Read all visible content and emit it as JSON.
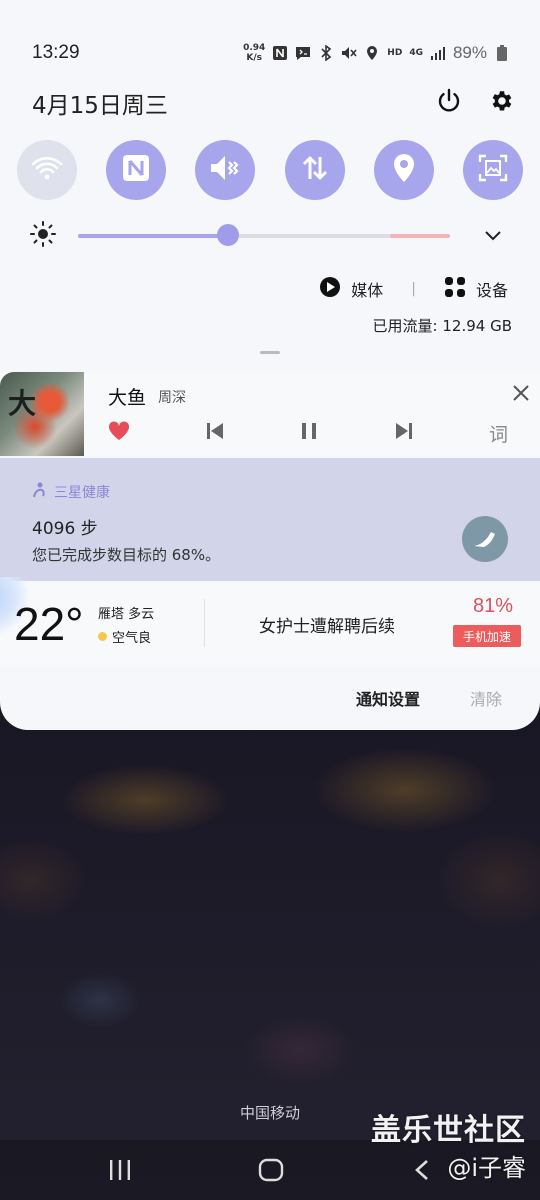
{
  "status_bar": {
    "time": "13:29",
    "net_speed_value": "0.94",
    "net_speed_unit": "K/s",
    "network_hd": "HD",
    "network_gen": "4G",
    "battery": "89%",
    "icons": [
      "nfc-icon",
      "message-icon",
      "bluetooth-icon",
      "mute-icon",
      "location-icon",
      "signal-icon",
      "battery-icon"
    ]
  },
  "header": {
    "date": "4月15日周三"
  },
  "quick_tiles": [
    {
      "name": "wifi",
      "icon": "wifi-icon",
      "state": "off"
    },
    {
      "name": "nfc",
      "icon": "nfc-icon",
      "state": "on"
    },
    {
      "name": "sound",
      "icon": "mute-icon",
      "state": "on"
    },
    {
      "name": "mobile-data",
      "icon": "data-arrows-icon",
      "state": "on"
    },
    {
      "name": "location",
      "icon": "location-icon",
      "state": "on"
    },
    {
      "name": "screenshot",
      "icon": "screen-capture-icon",
      "state": "on"
    }
  ],
  "brightness": {
    "level": 0.4
  },
  "media_row": {
    "media_label": "媒体",
    "separator": "|",
    "devices_label": "设备"
  },
  "data_usage": "已用流量: 12.94 GB",
  "music": {
    "album_glyph": "大",
    "title": "大鱼",
    "artist": "周深",
    "lyrics_label": "词"
  },
  "health": {
    "app_name": "三星健康",
    "steps": "4096 步",
    "progress_text": "您已完成步数目标的 68%。",
    "progress_fraction": 0.68
  },
  "weather": {
    "temperature": "22°",
    "city_condition": "雁塔 多云",
    "air_quality": "空气良"
  },
  "news": {
    "headline": "女护士遭解聘后续"
  },
  "boost": {
    "percent": "81%",
    "button_label": "手机加速"
  },
  "notification_actions": {
    "settings": "通知设置",
    "clear": "清除"
  },
  "carrier": "中国移动",
  "watermark": {
    "line1": "盖乐世社区",
    "line2": "@i子睿"
  },
  "colors": {
    "accent": "#a7a5ec",
    "health_bg": "#d2d5ea",
    "boost_red": "#ec5c5c"
  }
}
